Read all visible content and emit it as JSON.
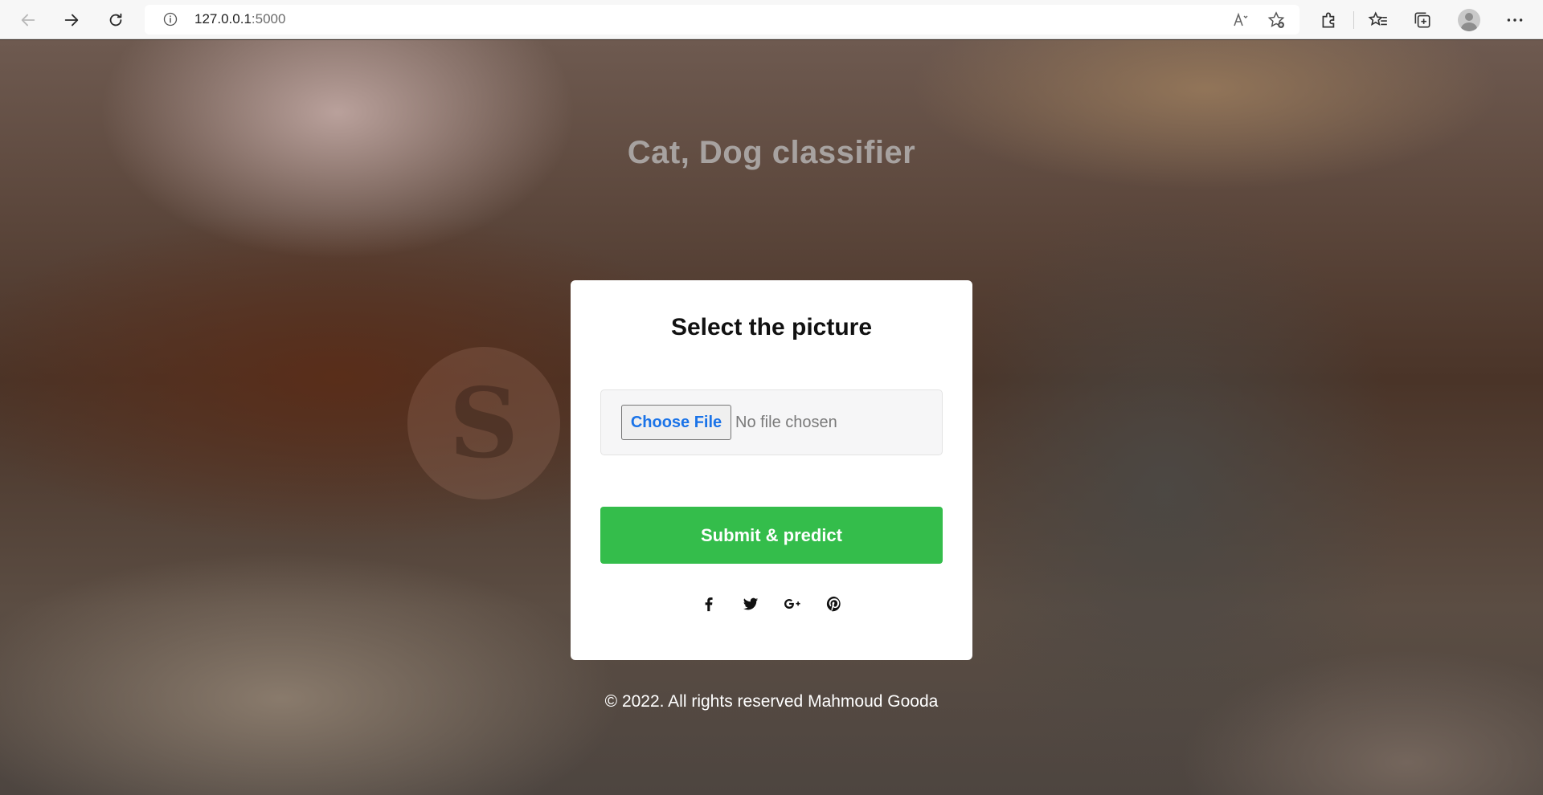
{
  "browser": {
    "url_host": "127.0.0.1",
    "url_port": ":5000",
    "icons": {
      "back": "arrow-left-icon",
      "forward": "arrow-right-icon",
      "refresh": "refresh-icon",
      "info": "info-icon",
      "read_aloud": "read-aloud-icon",
      "favorite_add": "star-add-icon",
      "extensions": "puzzle-icon",
      "favorites": "favorites-icon",
      "collections": "collections-icon",
      "profile": "avatar",
      "menu": "more-icon"
    }
  },
  "page": {
    "title": "Cat, Dog classifier",
    "card": {
      "title": "Select the picture",
      "choose_file": "Choose File",
      "no_file": "No file chosen",
      "submit": "Submit & predict",
      "socials": [
        "facebook-icon",
        "twitter-icon",
        "google-plus-icon",
        "pinterest-icon"
      ]
    },
    "footer": "© 2022. All rights reserved Mahmoud Gooda"
  },
  "colors": {
    "submit_bg": "#34bd4b",
    "file_button_text": "#1a73e8",
    "title_text": "#a7a2a0"
  }
}
